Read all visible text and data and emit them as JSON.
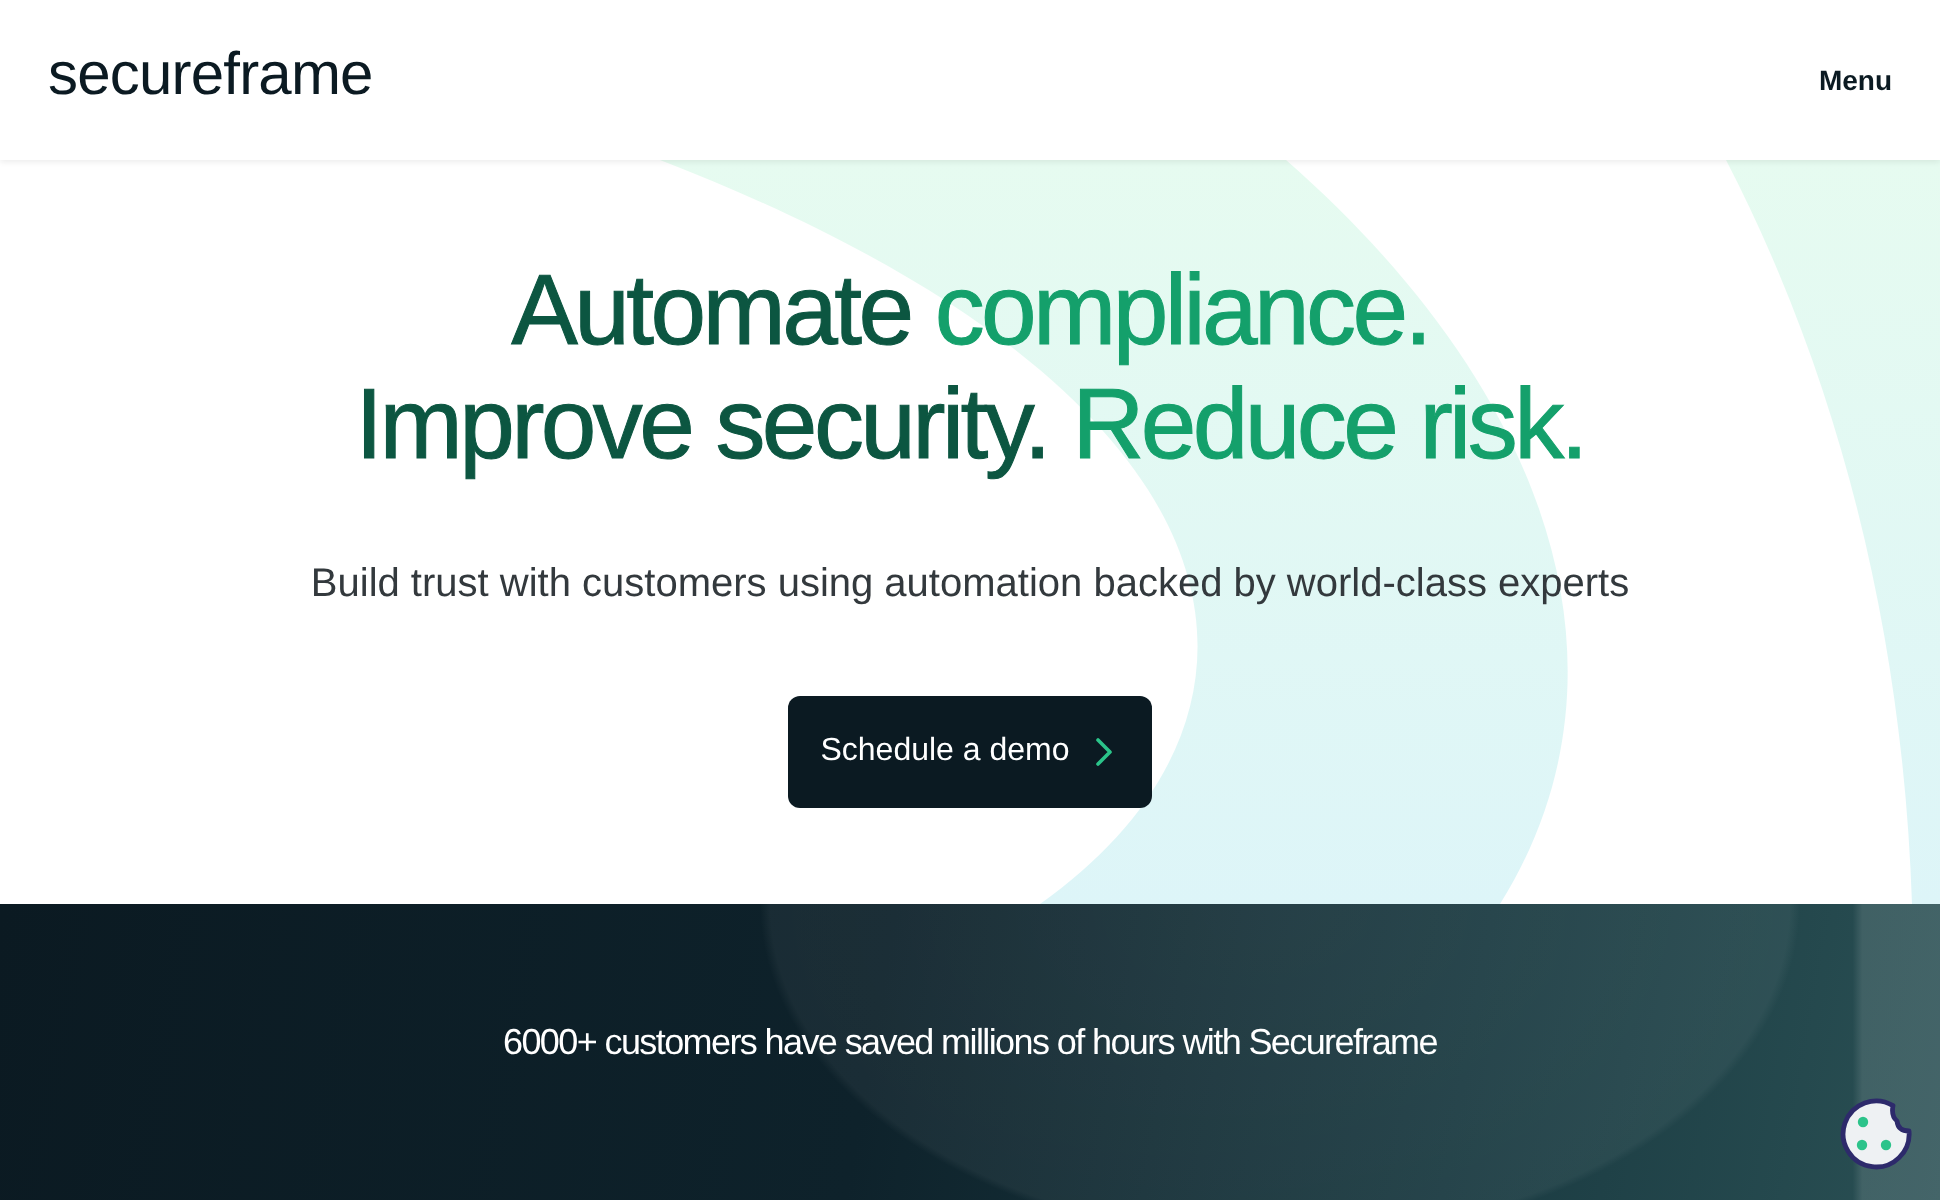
{
  "header": {
    "logo": "secureframe",
    "menu": "Menu"
  },
  "hero": {
    "headline_lines": [
      {
        "parts": [
          {
            "text": "Automate",
            "accent": false
          },
          {
            "text": "compliance.",
            "accent": true
          }
        ]
      },
      {
        "parts": [
          {
            "text": "Improve security.",
            "accent": false
          },
          {
            "text": "Reduce risk.",
            "accent": true
          }
        ]
      }
    ],
    "subtitle": "Build trust with customers using automation backed by world-class experts",
    "cta": {
      "label": "Schedule a demo"
    }
  },
  "customer_band": {
    "text": "6000+ customers have saved millions of hours with Secureframe"
  }
}
